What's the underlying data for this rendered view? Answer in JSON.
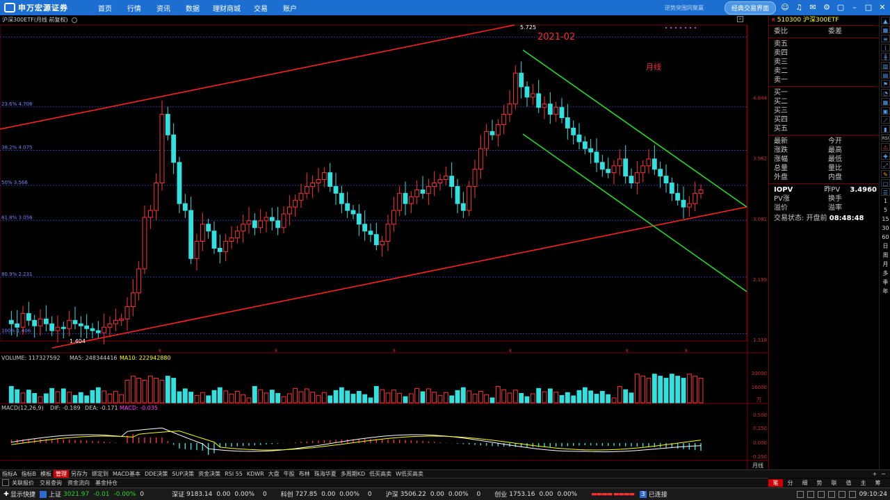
{
  "topbar": {
    "logo": "申万宏源证券",
    "nav": [
      "首页",
      "行情",
      "资讯",
      "数据",
      "理财商城",
      "交易",
      "账户"
    ],
    "slogan": "逆势突围同聚赢",
    "classic_btn": "经典交易界面"
  },
  "chart_header": {
    "title": "沪深300ETF(月线 前复权)",
    "volume_line": "VOLUME: 117327592",
    "ma5": "MA5: 248344416",
    "ma10": "MA10: 222942880",
    "macd_line": "MACD(12,26,9)",
    "dif": "DIF: -0.189",
    "dea": "DEA: -0.171",
    "macd": "MACD: -0.035",
    "period_label": "月线"
  },
  "annotations": {
    "high_label": "5.725",
    "low_label": "1.404",
    "date_label": "2021-02",
    "period_note": "月线",
    "fib": [
      "23.6% 4.708",
      "38.2% 4.075",
      "50% 3.566",
      "61.8% 3.056",
      "80.9% 2.231",
      "100% 1.406"
    ]
  },
  "price_axis": [
    "4.844",
    "3.962",
    "3.081",
    "2.199",
    "1.318"
  ],
  "vol_axis": [
    "30000",
    "16000",
    "万"
  ],
  "macd_axis": [
    "0.500",
    "0.250",
    "0.000",
    "-0.250"
  ],
  "quote": {
    "code": "510300",
    "name": "沪深300ETF",
    "r_tag": "R",
    "header_row": [
      "委比",
      "委差"
    ],
    "sells": [
      "卖五",
      "卖四",
      "卖三",
      "卖二",
      "卖一"
    ],
    "buys": [
      "买一",
      "买二",
      "买三",
      "买四",
      "买五"
    ],
    "stats": [
      [
        "最新",
        "今开"
      ],
      [
        "涨跌",
        "最高"
      ],
      [
        "涨幅",
        "最低"
      ],
      [
        "总量",
        "量比"
      ],
      [
        "外盘",
        "内盘"
      ]
    ],
    "iopv": [
      "IOPV",
      "昨PV",
      "3.4960"
    ],
    "pv_row": [
      "PV涨",
      "换手"
    ],
    "premium_row": [
      "溢价",
      "溢率"
    ],
    "status_label": "交易状态: 开盘前",
    "status_time": "08:48:48"
  },
  "right_tools_text": [
    "RSI",
    "1",
    "5",
    "15",
    "30",
    "60",
    "日",
    "周",
    "月",
    "多",
    "季",
    "年"
  ],
  "tabs1": [
    "指标A",
    "指标B",
    "模板",
    "管理",
    "另存为",
    "绑定到",
    "MACD基本",
    "DDE决策",
    "SUP决策",
    "资金决策",
    "RSI 55",
    "KDWR",
    "大盘",
    "牛股",
    "布林",
    "珠海华夏",
    "多周期KD",
    "低买高卖",
    "W低买高卖"
  ],
  "tabs1_selected": "管理",
  "tabs2": [
    "关联报价",
    "交易查询",
    "资金流向",
    "基金持仓"
  ],
  "tabsr": [
    "+",
    "−"
  ],
  "pagesel": [
    "笔",
    "分",
    "细",
    "势",
    "联",
    "值",
    "主",
    "筹"
  ],
  "pagesel_selected": "笔",
  "statusbar": {
    "quick": "显示快捷",
    "sh_name": "上证",
    "sh_val": "3021.97",
    "sh_chg": "-0.01",
    "sh_pct": "-0.00%",
    "sh_vol": "0",
    "sz_name": "深证",
    "sz_val": "9183.14",
    "sz_chg": "0.00",
    "sz_pct": "0.00%",
    "sz_vol": "0",
    "kc_name": "科创",
    "kc_val": "727.85",
    "kc_chg": "0.00",
    "kc_pct": "0.00%",
    "kc_vol": "0",
    "hs_name": "沪深",
    "hs_val": "3506.22",
    "hs_chg": "0.00",
    "hs_pct": "0.00%",
    "hs_vol": "0",
    "cy_name": "创业",
    "cy_val": "1753.16",
    "cy_chg": "0.00",
    "cy_pct": "0.00%",
    "conn_num": "3",
    "conn_text": "已连接",
    "time": "09:10:24"
  },
  "colors": {
    "up": "#ff3333",
    "down": "#33e0e0",
    "channel_red": "#ff2020",
    "channel_green": "#22dd22",
    "fib_line": "#2a3a9a",
    "topbar": "#1c6fd0"
  }
}
